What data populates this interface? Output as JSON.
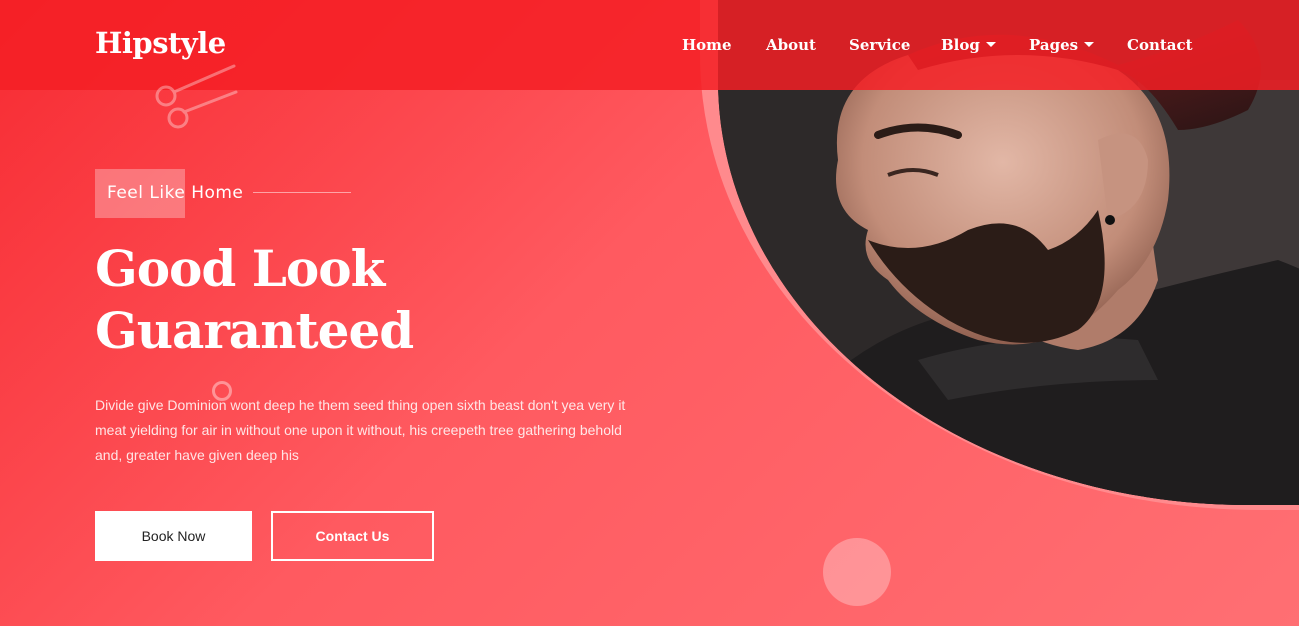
{
  "brand": {
    "logo": "Hipstyle"
  },
  "nav": {
    "items": [
      {
        "label": "Home",
        "dropdown": false
      },
      {
        "label": "About",
        "dropdown": false
      },
      {
        "label": "Service",
        "dropdown": false
      },
      {
        "label": "Blog",
        "dropdown": true
      },
      {
        "label": "Pages",
        "dropdown": true
      },
      {
        "label": "Contact",
        "dropdown": false
      }
    ]
  },
  "hero": {
    "tagline": "Feel Like Home",
    "headline_line1": "Good Look",
    "headline_line2": "Guaranteed",
    "description": "Divide give Dominion wont deep he them seed thing open sixth beast don't yea very it meat yielding for air in without one upon it without, his creepeth tree gathering behold and, greater have given deep his",
    "primary_button": "Book Now",
    "secondary_button": "Contact Us"
  },
  "colors": {
    "accent": "#f72b32",
    "accent_light": "#ff6f73",
    "button_bg": "#ffffff"
  },
  "icons": {
    "decoration": "scissors-icon",
    "dropdown": "caret-down-icon"
  }
}
